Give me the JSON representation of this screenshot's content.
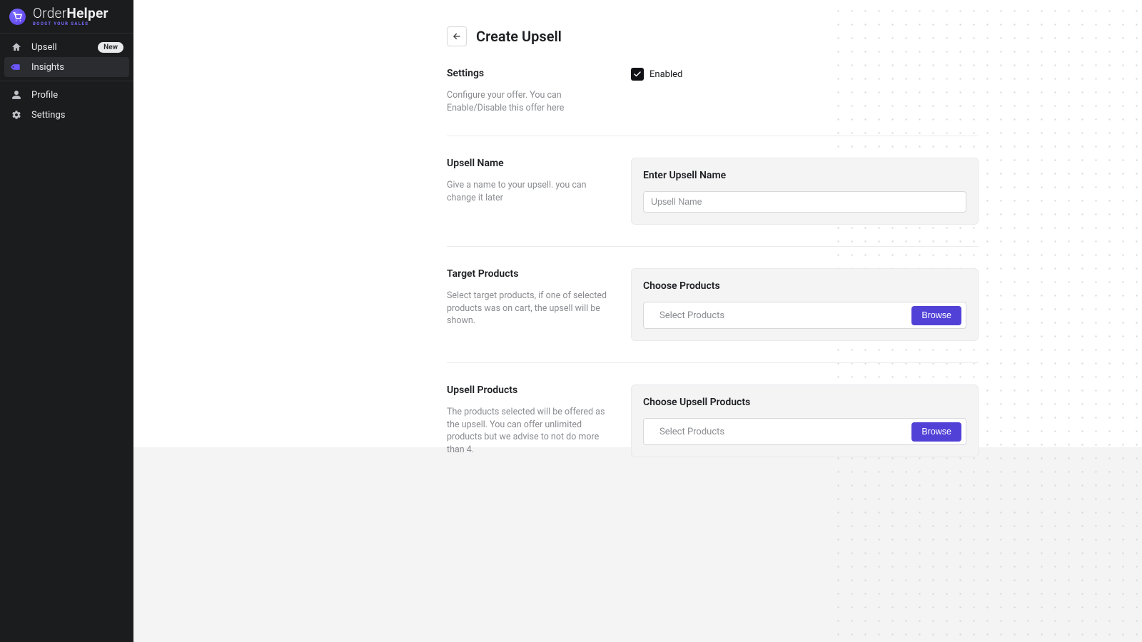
{
  "brand": {
    "name_prefix": "Order",
    "name_bold": "Helper",
    "tagline": "BOOST YOUR SALES"
  },
  "sidebar": {
    "group1": [
      {
        "icon": "home",
        "label": "Upsell",
        "badge": "New",
        "active": false
      },
      {
        "icon": "tag",
        "label": "Insights",
        "badge": null,
        "active": true
      }
    ],
    "group2": [
      {
        "icon": "user",
        "label": "Profile"
      },
      {
        "icon": "gear",
        "label": "Settings"
      }
    ]
  },
  "page": {
    "title": "Create Upsell"
  },
  "sections": {
    "settings": {
      "title": "Settings",
      "desc": "Configure your offer. You can Enable/Disable this offer here",
      "checkbox_label": "Enabled",
      "checked": true
    },
    "upsell_name": {
      "title": "Upsell Name",
      "desc": "Give a name to your upsell. you can change it later",
      "card_title": "Enter Upsell Name",
      "placeholder": "Upsell Name"
    },
    "target_products": {
      "title": "Target Products",
      "desc": "Select target products, if one of selected products was on cart, the upsell will be shown.",
      "card_title": "Choose Products",
      "placeholder": "Select Products",
      "browse": "Browse"
    },
    "upsell_products": {
      "title": "Upsell Products",
      "desc": "The products selected will be offered as the upsell. You can offer unlimited products but we advise to not do more than 4.",
      "card_title": "Choose Upsell Products",
      "placeholder": "Select Products",
      "browse": "Browse"
    }
  }
}
